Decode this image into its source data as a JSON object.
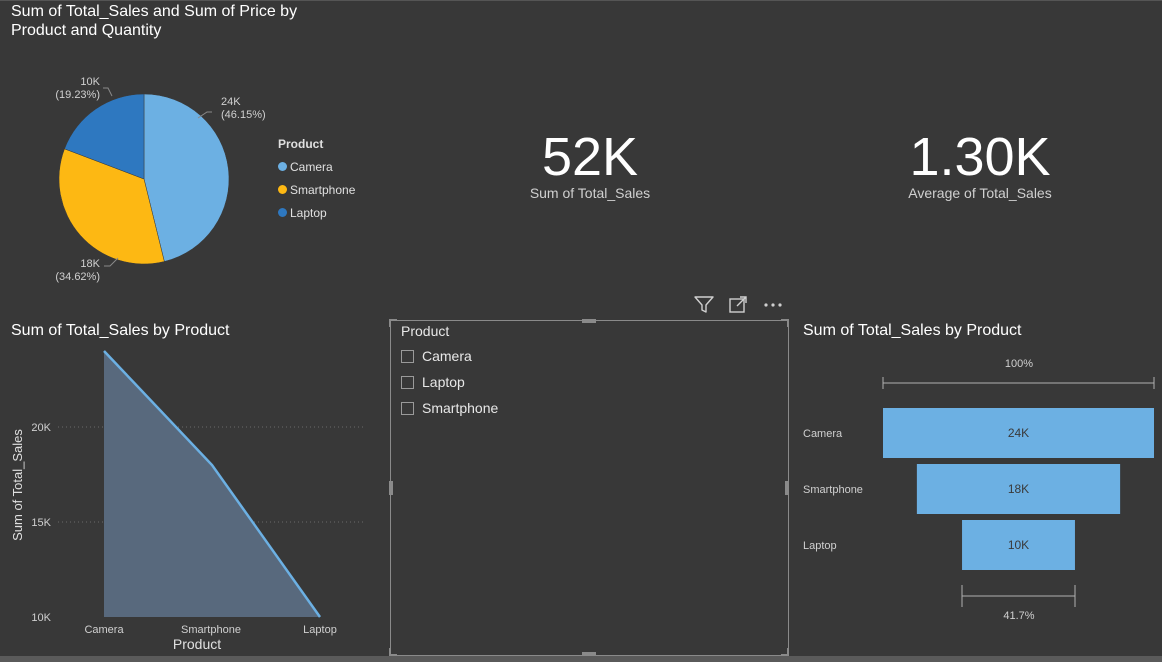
{
  "pie_panel": {
    "title_line1": "Sum of Total_Sales and Sum of Price by",
    "title_line2": "Product and Quantity",
    "legend_title": "Product",
    "legend": [
      {
        "label": "Camera",
        "color": "#6cb0e3"
      },
      {
        "label": "Smartphone",
        "color": "#fdb813"
      },
      {
        "label": "Laptop",
        "color": "#2e78c0"
      }
    ],
    "labels": {
      "camera_value": "24K",
      "camera_pct": "(46.15%)",
      "smartphone_value": "18K",
      "smartphone_pct": "(34.62%)",
      "laptop_value": "10K",
      "laptop_pct": "(19.23%)"
    }
  },
  "kpi1": {
    "value": "52K",
    "label": "Sum of Total_Sales"
  },
  "kpi2": {
    "value": "1.30K",
    "label": "Average of Total_Sales"
  },
  "area_panel": {
    "title": "Sum of Total_Sales by Product",
    "xlabel": "Product",
    "ylabel": "Sum of Total_Sales",
    "yticks": [
      "20K",
      "15K",
      "10K"
    ],
    "xticks": [
      "Camera",
      "Smartphone",
      "Laptop"
    ]
  },
  "slicer": {
    "header": "Product",
    "items": [
      "Camera",
      "Laptop",
      "Smartphone"
    ],
    "icons": [
      "filter-icon",
      "focus-mode-icon",
      "more-options-icon"
    ]
  },
  "funnel_panel": {
    "title": "Sum of Total_Sales by Product",
    "top_pct": "100%",
    "bottom_pct": "41.7%",
    "rows": [
      {
        "label": "Camera",
        "value_label": "24K"
      },
      {
        "label": "Smartphone",
        "value_label": "18K"
      },
      {
        "label": "Laptop",
        "value_label": "10K"
      }
    ]
  },
  "chart_data": [
    {
      "type": "pie",
      "title": "Sum of Total_Sales and Sum of Price by Product and Quantity",
      "categories": [
        "Camera",
        "Smartphone",
        "Laptop"
      ],
      "values": [
        24000,
        18000,
        10000
      ],
      "percents": [
        46.15,
        34.62,
        19.23
      ],
      "colors": [
        "#6cb0e3",
        "#fdb813",
        "#2e78c0"
      ],
      "legend": "right"
    },
    {
      "type": "area",
      "title": "Sum of Total_Sales by Product",
      "xlabel": "Product",
      "ylabel": "Sum of Total_Sales",
      "categories": [
        "Camera",
        "Smartphone",
        "Laptop"
      ],
      "values": [
        24000,
        18000,
        10000
      ],
      "ylim": [
        10000,
        24000
      ],
      "yticks": [
        10000,
        15000,
        20000
      ],
      "grid": true
    },
    {
      "type": "bar",
      "subtype": "funnel",
      "title": "Sum of Total_Sales by Product",
      "categories": [
        "Camera",
        "Smartphone",
        "Laptop"
      ],
      "values": [
        24000,
        18000,
        10000
      ]
    }
  ]
}
